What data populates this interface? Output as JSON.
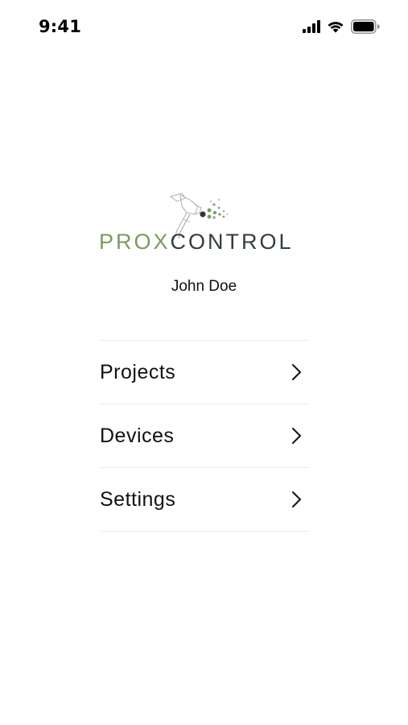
{
  "status_bar": {
    "time": "9:41",
    "icons": [
      "cellular-signal-icon",
      "wifi-icon",
      "battery-icon"
    ]
  },
  "logo": {
    "text_prox": "PROX",
    "text_control": "CONTROL",
    "colors": {
      "prox": "#7a9a5e",
      "control": "#333d3d"
    }
  },
  "user": {
    "name": "John Doe"
  },
  "menu": {
    "items": [
      {
        "label": "Projects",
        "icon": "chevron-right-icon"
      },
      {
        "label": "Devices",
        "icon": "chevron-right-icon"
      },
      {
        "label": "Settings",
        "icon": "chevron-right-icon"
      }
    ]
  }
}
